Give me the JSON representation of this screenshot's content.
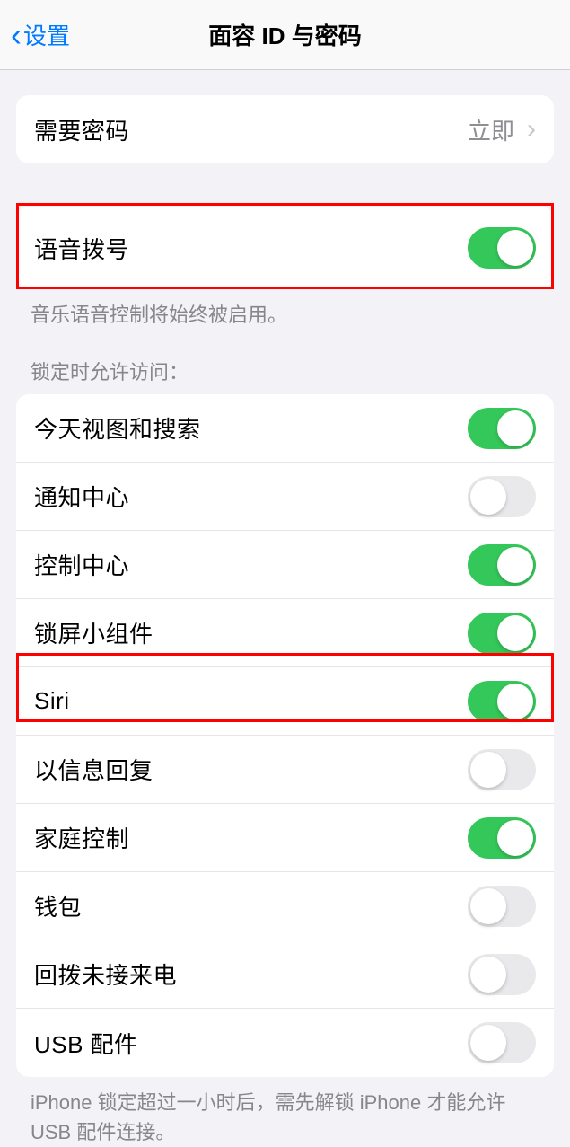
{
  "header": {
    "back_label": "设置",
    "title": "面容 ID 与密码"
  },
  "passcode_group": {
    "require_passcode": {
      "label": "需要密码",
      "value": "立即"
    }
  },
  "voice_dial": {
    "label": "语音拨号",
    "on": true,
    "footer": "音乐语音控制将始终被启用。"
  },
  "locked_access": {
    "header": "锁定时允许访问：",
    "items": [
      {
        "label": "今天视图和搜索",
        "on": true
      },
      {
        "label": "通知中心",
        "on": false
      },
      {
        "label": "控制中心",
        "on": true
      },
      {
        "label": "锁屏小组件",
        "on": true
      },
      {
        "label": "Siri",
        "on": true
      },
      {
        "label": "以信息回复",
        "on": false
      },
      {
        "label": "家庭控制",
        "on": true
      },
      {
        "label": "钱包",
        "on": false
      },
      {
        "label": "回拨未接来电",
        "on": false
      },
      {
        "label": "USB 配件",
        "on": false
      }
    ],
    "footer": "iPhone 锁定超过一小时后，需先解锁 iPhone 才能允许USB 配件连接。"
  }
}
